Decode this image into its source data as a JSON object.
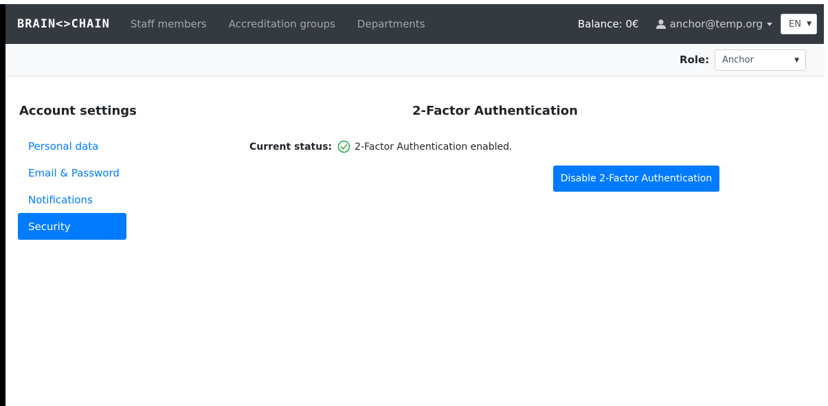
{
  "navbar": {
    "brand": "BRAIN<>CHAIN",
    "links": [
      "Staff members",
      "Accreditation groups",
      "Departments"
    ],
    "balance": "Balance: 0€",
    "user_email": "anchor@temp.org",
    "language": "EN"
  },
  "role_bar": {
    "label": "Role:",
    "selected": "Anchor"
  },
  "sidebar": {
    "title": "Account settings",
    "items": [
      {
        "label": "Personal data",
        "active": false
      },
      {
        "label": "Email & Password",
        "active": false
      },
      {
        "label": "Notifications",
        "active": false
      },
      {
        "label": "Security",
        "active": true
      }
    ]
  },
  "main": {
    "title": "2-Factor Authentication",
    "status_label": "Current status:",
    "status_text": "2-Factor Authentication enabled.",
    "disable_button": "Disable 2-Factor Authentication"
  },
  "colors": {
    "navbar_bg": "#343a40",
    "primary": "#007bff",
    "success": "#28a745"
  }
}
